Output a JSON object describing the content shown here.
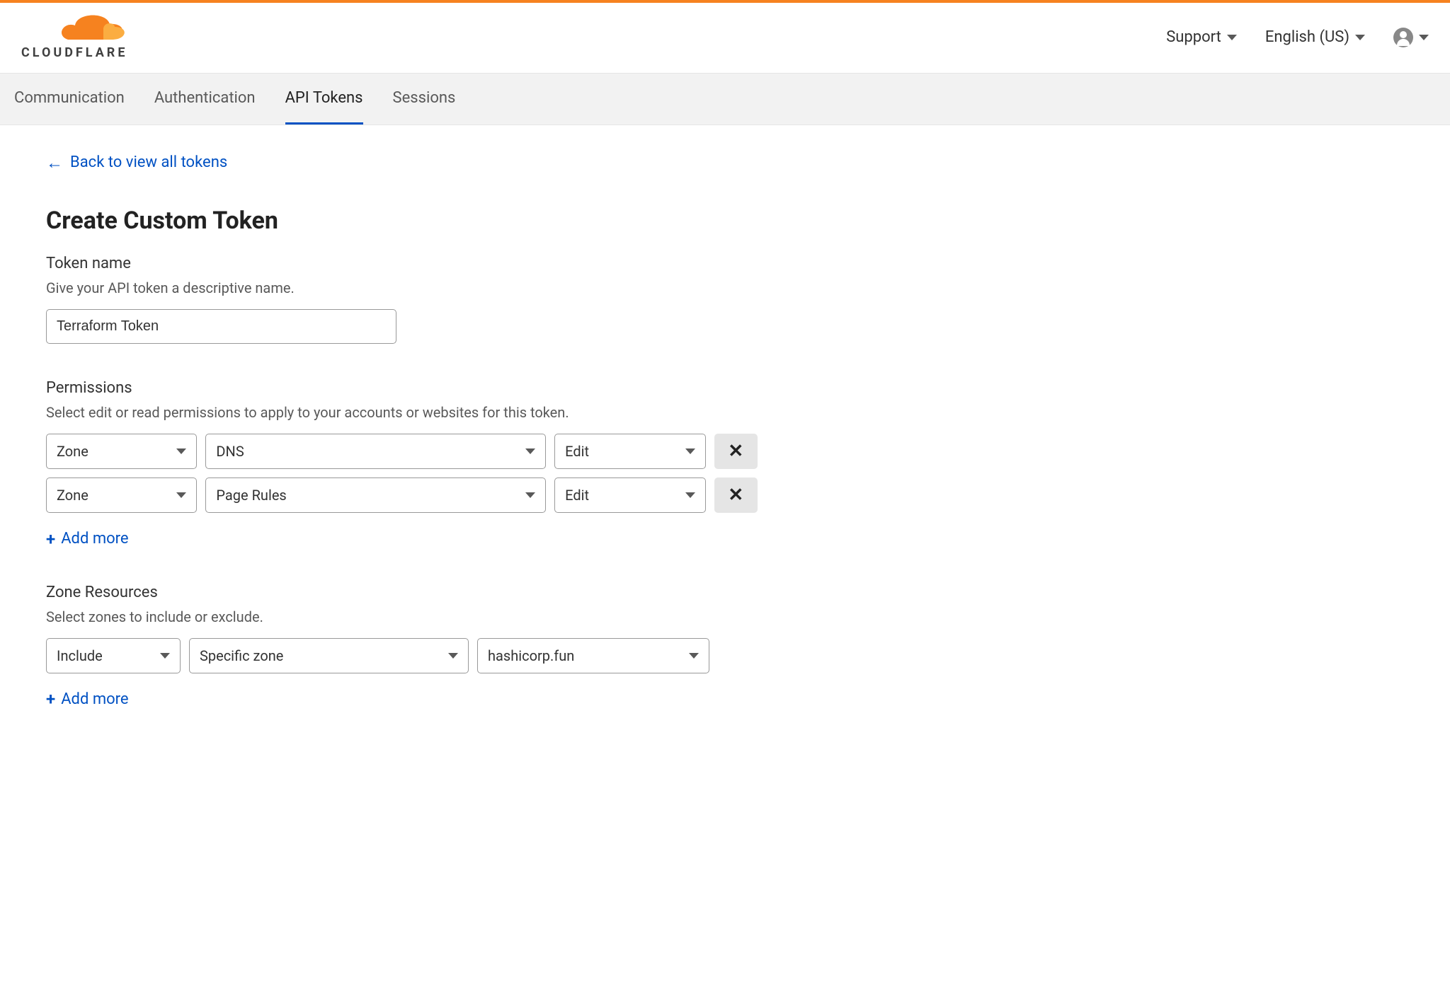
{
  "brand": {
    "name": "CLOUDFLARE"
  },
  "header": {
    "support": "Support",
    "language": "English (US)"
  },
  "tabs": [
    {
      "label": "Communication",
      "active": false
    },
    {
      "label": "Authentication",
      "active": false
    },
    {
      "label": "API Tokens",
      "active": true
    },
    {
      "label": "Sessions",
      "active": false
    }
  ],
  "back_link": "Back to view all tokens",
  "page_title": "Create Custom Token",
  "token_name": {
    "label": "Token name",
    "help": "Give your API token a descriptive name.",
    "value": "Terraform Token"
  },
  "permissions": {
    "label": "Permissions",
    "help": "Select edit or read permissions to apply to your accounts or websites for this token.",
    "rows": [
      {
        "scope": "Zone",
        "resource": "DNS",
        "level": "Edit"
      },
      {
        "scope": "Zone",
        "resource": "Page Rules",
        "level": "Edit"
      }
    ],
    "add_more": "Add more"
  },
  "zone_resources": {
    "label": "Zone Resources",
    "help": "Select zones to include or exclude.",
    "rows": [
      {
        "mode": "Include",
        "scope": "Specific zone",
        "value": "hashicorp.fun"
      }
    ],
    "add_more": "Add more"
  }
}
